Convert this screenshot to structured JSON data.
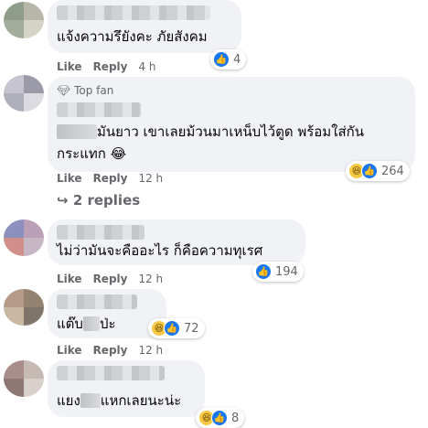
{
  "comments": [
    {
      "text": "แจ้งความรึยังคะ ภัยสังคม",
      "actions": {
        "like": "Like",
        "reply": "Reply",
        "time": "4 h"
      },
      "reaction_count": "4",
      "reaction_icons": [
        "like-icon"
      ]
    },
    {
      "badge": "Top fan",
      "badge_icon": "diamond-icon",
      "text_line1_after_blur": "มันยาว เขาเลยม้วนมาเหน็บไว้ตูด พร้อมใส่กัน",
      "text_line2": "กระแทก 😂",
      "actions": {
        "like": "Like",
        "reply": "Reply",
        "time": "12 h"
      },
      "reaction_count": "264",
      "reaction_icons": [
        "haha-icon",
        "like-icon"
      ],
      "replies_label": "2 replies",
      "replies_icon": "reply-arrow-icon"
    },
    {
      "text": "ไม่ว่ามันจะคืออะไร ก็คือความทุเรศ",
      "actions": {
        "like": "Like",
        "reply": "Reply",
        "time": "12 h"
      },
      "reaction_count": "194",
      "reaction_icons": [
        "like-icon"
      ]
    },
    {
      "text_before_blur": "แต๊บ",
      "text_after_blur": "ป่ะ",
      "actions": {
        "like": "Like",
        "reply": "Reply",
        "time": "12 h"
      },
      "reaction_count": "72",
      "reaction_icons": [
        "haha-icon",
        "like-icon"
      ]
    },
    {
      "text_before_blur": "แยง",
      "text_after_blur": "แหกเลยนะน่ะ",
      "actions": {
        "like": "Like",
        "reply": "Reply",
        "time": "12 h"
      },
      "reaction_count": "8",
      "reaction_icons": [
        "haha-icon",
        "like-icon"
      ]
    }
  ]
}
